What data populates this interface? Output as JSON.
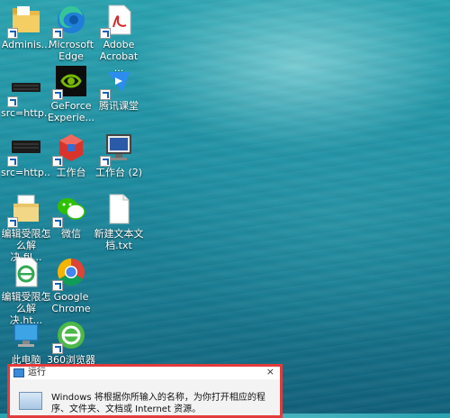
{
  "desktop": {
    "icons": [
      {
        "id": "admin",
        "label": "Adminis..."
      },
      {
        "id": "edge",
        "label": "Microsoft Edge"
      },
      {
        "id": "acrobat",
        "label": "Adobe Acrobat ..."
      },
      {
        "id": "src1",
        "label": "src=http..."
      },
      {
        "id": "geforce",
        "label": "GeForce Experie..."
      },
      {
        "id": "tencent",
        "label": "腾讯课堂"
      },
      {
        "id": "src2",
        "label": "src=http..."
      },
      {
        "id": "workbench",
        "label": "工作台"
      },
      {
        "id": "workbench2",
        "label": "工作台 (2)"
      },
      {
        "id": "edit-folder",
        "label": "编辑受限怎么解决.fil..."
      },
      {
        "id": "wechat",
        "label": "微信"
      },
      {
        "id": "newtxt",
        "label": "新建文本文档.txt"
      },
      {
        "id": "edit-html",
        "label": "编辑受限怎么解决.ht..."
      },
      {
        "id": "chrome",
        "label": "Google Chrome"
      },
      {
        "id": "thispc",
        "label": "此电脑"
      },
      {
        "id": "browser360",
        "label": "360浏览器"
      }
    ]
  },
  "run_dialog": {
    "title": "运行",
    "close": "×",
    "description": "Windows 将根据你所输入的名称，为你打开相应的程序、文件夹、文档或 Internet 资源。"
  },
  "colors": {
    "highlight_border": "#e23b3b",
    "desktop_water": "#1d8fa2"
  }
}
